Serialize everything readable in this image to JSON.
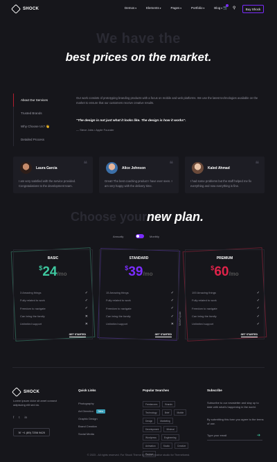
{
  "header": {
    "logo": "SHOCK",
    "nav": [
      "Demos",
      "Elements",
      "Pages",
      "Portfolio",
      "Blog"
    ],
    "buy_label": "Buy Shock"
  },
  "hero": {
    "ghost": "We have the",
    "title": "best prices on the market."
  },
  "tabs": {
    "items": [
      "About Our Services",
      "Trusted Brands",
      "Why Choose Us? 👋",
      "Detailed Process"
    ],
    "description": "Our work consists of prototyping branding products with a focus on mobile and web platforms. We use the latest technologies available on the market to ensure that our customers receive creative results.",
    "quote": "\"The design is not just what it looks like. The design is how it works\".",
    "quote_author": "— Steve Jobs • Apple Founder"
  },
  "testimonials": [
    {
      "name": "Laura Garcia",
      "text": "I am very satisfied with the service provided. Congratulations to the development team."
    },
    {
      "name": "Alice Johnson",
      "text": "Great! The best coaching product I have ever seen. I am very happy with the delivery time."
    },
    {
      "name": "Kaled Ahmad",
      "text": "I had some problems but the staff helped me fix everything and now everything is fine."
    }
  ],
  "plans": {
    "ghost": "Choose your",
    "title": "new plan.",
    "toggle_left": "Annually",
    "toggle_right": "Monthly",
    "vertical_label": "Most Popular",
    "cards": [
      {
        "name": "BASIC",
        "price": "24",
        "currency": "$",
        "period": "/mo",
        "color": "#3ec8a0",
        "button": "GET STARTED",
        "features": [
          [
            "3 Amazing things",
            "✓"
          ],
          [
            "Fully related to work",
            "✓"
          ],
          [
            "Freedom to navigate",
            "✓"
          ],
          [
            "Can bring the family",
            "✕"
          ],
          [
            "Unlimited support",
            "✕"
          ]
        ]
      },
      {
        "name": "STANDARD",
        "price": "39",
        "currency": "$",
        "period": "/mo",
        "color": "#7b2cff",
        "button": "GET STARTED",
        "features": [
          [
            "15 Amazing things",
            "✓"
          ],
          [
            "Fully related to work",
            "✓"
          ],
          [
            "Freedom to navigate",
            "✓"
          ],
          [
            "Can bring the family",
            "✓"
          ],
          [
            "Unlimited support",
            "✕"
          ]
        ]
      },
      {
        "name": "PREMIUM",
        "price": "60",
        "currency": "$",
        "period": "/mo",
        "color": "#e0234a",
        "button": "GET STARTED",
        "features": [
          [
            "100 Amazing things",
            "✓"
          ],
          [
            "Fully related to work",
            "✓"
          ],
          [
            "Freedom to navigate",
            "✓"
          ],
          [
            "Can bring the family",
            "✓"
          ],
          [
            "Unlimited support",
            "✓"
          ]
        ]
      }
    ]
  },
  "footer": {
    "logo": "SHOCK",
    "about": "Lorem ipsum dolor sit amet consect adipiscing elit sed do.",
    "social": [
      "f",
      "t",
      "in"
    ],
    "phone": "+1 (89) 7256 9420",
    "quick_title": "Quick Links",
    "quick_links": [
      "Photography",
      "Art Direction",
      "Graphic Design",
      "Brand Creation",
      "Social Media"
    ],
    "quick_badge": "New",
    "popular_title": "Popular Searches",
    "tags": [
      "Freelancers",
      "Brands",
      "Technology",
      "Brief",
      "Mobile",
      "Design",
      "Marketing",
      "Development",
      "Minimal",
      "Wordpress",
      "Engineering",
      "Animation",
      "Studio",
      "Creative",
      "Product"
    ],
    "subscribe_title": "Subscribe",
    "subscribe_text": "Subscribe to our newsletter and stay up to date with what's happening in the world.",
    "subscribe_terms": "By submitting this form you agree to the terms of use.",
    "email_placeholder": "Type your email",
    "copyright": "© 2023 - All rights reserved. For Shock Theme by shock creative studio for Themeforest."
  }
}
